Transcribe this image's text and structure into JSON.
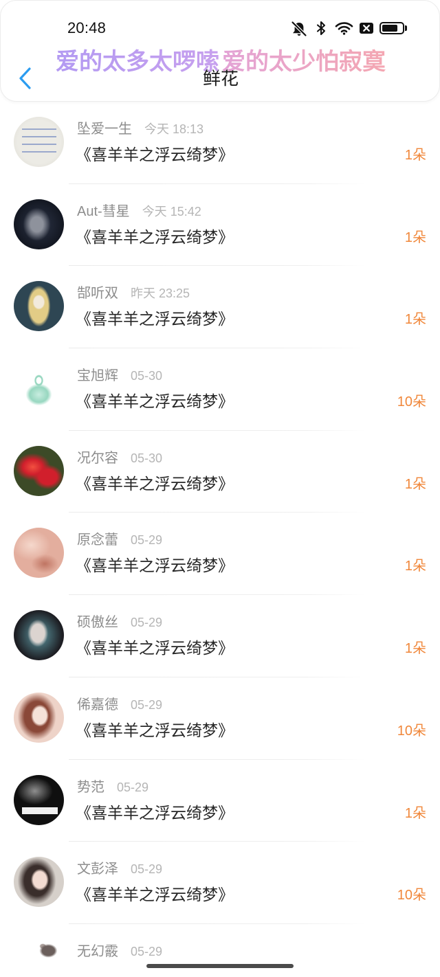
{
  "status_bar": {
    "time": "20:48",
    "battery_level": 0.8,
    "icons": [
      "bell-mute-icon",
      "bluetooth-icon",
      "wifi-icon",
      "no-sim-icon",
      "battery-icon"
    ]
  },
  "banner": {
    "text_left": "爱的太多太啰嗦",
    "text_right": "爱的太少怕寂寞",
    "colors": {
      "left_start": "#b39af2",
      "left_end": "#c7a0ee",
      "right_start": "#e3a3d6",
      "right_end": "#f4a7b2"
    }
  },
  "header": {
    "title": "鲜花",
    "back_icon": "chevron-left-icon"
  },
  "colors": {
    "accent": "#2b9cf0",
    "count": "#f0873a",
    "name": "#8d8d8d",
    "time": "#b5b5b5",
    "title": "#272727"
  },
  "list": {
    "items": [
      {
        "name": "坠爱一生",
        "time": "今天 18:13",
        "title": "《喜羊羊之浮云绮梦》",
        "count": "1朵",
        "avatar_colors": [
          "#ecebe5",
          "#9aa8cc",
          "#dcd9d0"
        ]
      },
      {
        "name": "Aut-彗星",
        "time": "今天 15:42",
        "title": "《喜羊羊之浮云绮梦》",
        "count": "1朵",
        "avatar_colors": [
          "#121620",
          "#8e929c",
          "#2d3548"
        ]
      },
      {
        "name": "郜听双",
        "time": "昨天 23:25",
        "title": "《喜羊羊之浮云绮梦》",
        "count": "1朵",
        "avatar_colors": [
          "#2e4653",
          "#e2cc86",
          "#f2eadc"
        ]
      },
      {
        "name": "宝旭辉",
        "time": "05-30",
        "title": "《喜羊羊之浮云绮梦》",
        "count": "10朵",
        "avatar_colors": [
          "#ffffff",
          "#98d7c0",
          "#c8ede0"
        ]
      },
      {
        "name": "况尔容",
        "time": "05-30",
        "title": "《喜羊羊之浮云绮梦》",
        "count": "1朵",
        "avatar_colors": [
          "#3c4a27",
          "#d11f2c",
          "#f25040"
        ]
      },
      {
        "name": "原念蕾",
        "time": "05-29",
        "title": "《喜羊羊之浮云绮梦》",
        "count": "1朵",
        "avatar_colors": [
          "#e3ae9e",
          "#bf7462",
          "#f5d8cc"
        ]
      },
      {
        "name": "硕傲丝",
        "time": "05-29",
        "title": "《喜羊羊之浮云绮梦》",
        "count": "1朵",
        "avatar_colors": [
          "#1d1e23",
          "#dcd4d0",
          "#5f9aa4"
        ]
      },
      {
        "name": "俙嘉德",
        "time": "05-29",
        "title": "《喜羊羊之浮云绮梦》",
        "count": "10朵",
        "avatar_colors": [
          "#eed3c8",
          "#8a4838",
          "#f5e2d9"
        ]
      },
      {
        "name": "势范",
        "time": "05-29",
        "title": "《喜羊羊之浮云绮梦》",
        "count": "1朵",
        "avatar_colors": [
          "#0f0f0f",
          "#8f8f8f",
          "#efefef"
        ]
      },
      {
        "name": "文彭泽",
        "time": "05-29",
        "title": "《喜羊羊之浮云绮梦》",
        "count": "10朵",
        "avatar_colors": [
          "#d6d0ca",
          "#3a2e2b",
          "#f3dcd2"
        ]
      },
      {
        "name": "无幻霰",
        "time": "05-29",
        "avatar_colors": [
          "#ffffff",
          "#6b5f5c",
          "#a89c98"
        ]
      }
    ]
  }
}
